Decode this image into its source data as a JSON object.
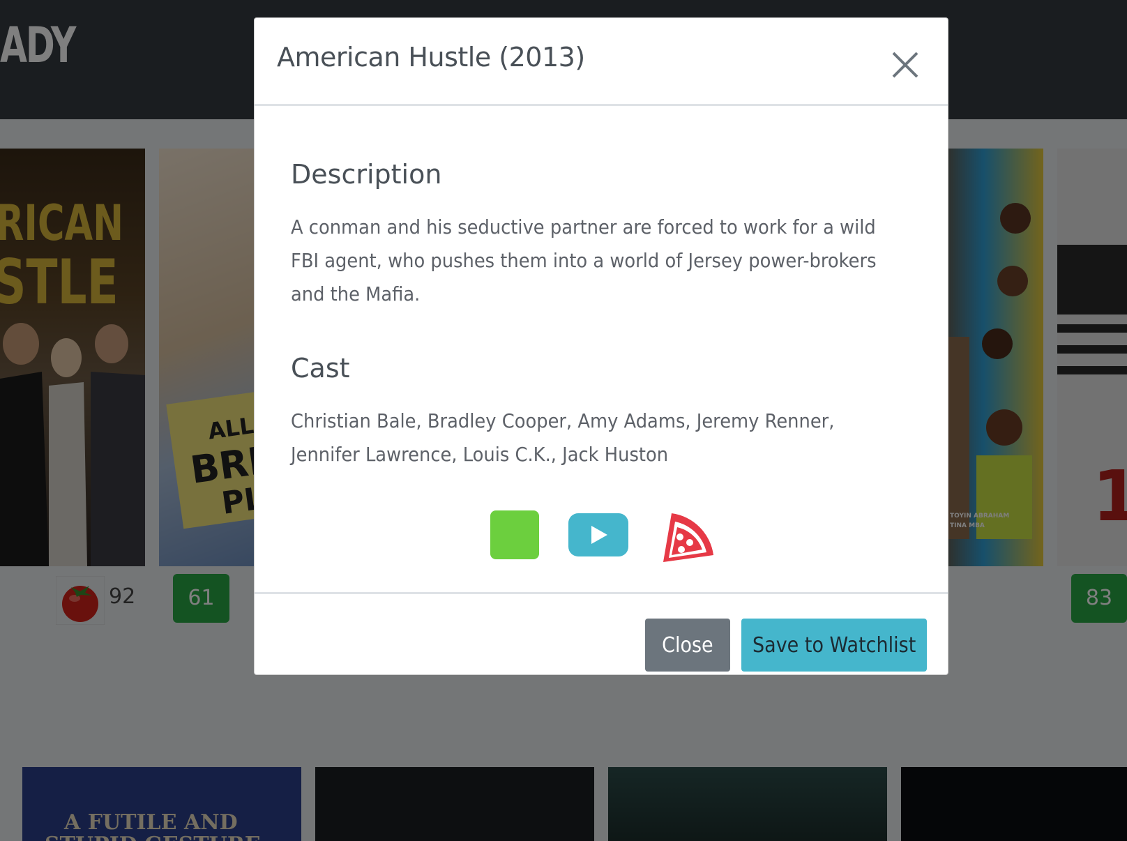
{
  "navbar": {
    "brand_fragment": "ADY"
  },
  "background": {
    "cards": [
      {
        "poster_text": "RICAN",
        "poster_text_2": "STLE",
        "rating_type": "rotten-tomatoes",
        "score": "92"
      },
      {
        "poster_text": "ALL T",
        "poster_text_2": "BRIG",
        "poster_text_3": "PL",
        "score": "61"
      },
      {
        "poster_text": "TOYIN ABRAHAM",
        "poster_text_2": "TINA MBA"
      },
      {
        "poster_text": "1",
        "score": "83"
      }
    ],
    "row2_text": "A FUTILE AND",
    "row2_text_2": "STUPID GESTURE"
  },
  "modal": {
    "title": "American Hustle (2013)",
    "description_heading": "Description",
    "description": "A conman and his seductive partner are forced to work for a wild FBI agent, who pushes them into a world of Jersey power-brokers and the Mafia.",
    "cast_heading": "Cast",
    "cast": "Christian Bale, Bradley Cooper, Amy Adams, Jeremy Renner, Jennifer Lawrence, Louis C.K., Jack Huston",
    "links": [
      {
        "icon": "green-square-icon",
        "color": "#6ccf3e"
      },
      {
        "icon": "youtube-play-icon",
        "color": "#45b6cc"
      },
      {
        "icon": "pizza-slice-icon",
        "color": "#e63946"
      }
    ],
    "close_label": "Close",
    "save_label": "Save to Watchlist"
  },
  "colors": {
    "navbar": "#343a40",
    "score_badge": "#28a745",
    "close_button": "#6c757d",
    "save_button": "#45b6cc"
  }
}
